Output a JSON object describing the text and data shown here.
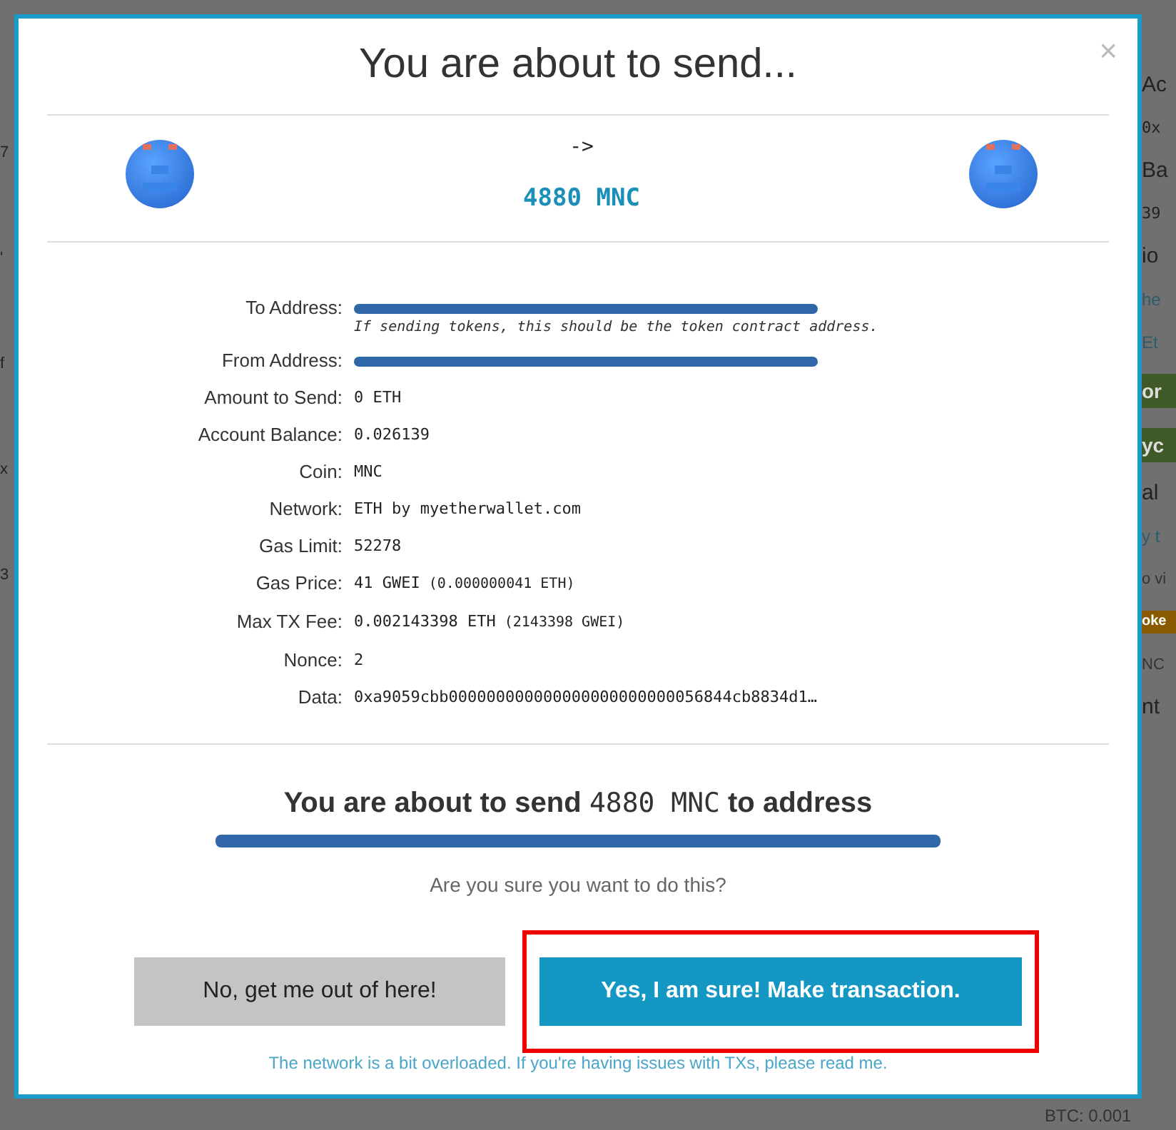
{
  "backdrop": {
    "left_fragments": [
      "7",
      "'",
      "f",
      "x",
      "3"
    ],
    "right_fragments": [
      {
        "text": "Ac",
        "kind": "heading"
      },
      {
        "text": "0x",
        "kind": "mono"
      },
      {
        "text": "Ba",
        "kind": "heading"
      },
      {
        "text": "39",
        "kind": "mono"
      },
      {
        "text": "io",
        "kind": "heading"
      },
      {
        "text": "he",
        "kind": "link"
      },
      {
        "text": "Et",
        "kind": "link"
      },
      {
        "text": "or",
        "kind": "banner"
      },
      {
        "text": "yc",
        "kind": "banner"
      },
      {
        "text": "al",
        "kind": "heading"
      },
      {
        "text": "y t",
        "kind": "link"
      },
      {
        "text": "o vi",
        "kind": "muted"
      },
      {
        "text": "oke",
        "kind": "tag"
      },
      {
        "text": "NC",
        "kind": "muted"
      },
      {
        "text": "nt",
        "kind": "heading"
      }
    ],
    "bottom_fragment": "BTC: 0.001"
  },
  "modal": {
    "title": "You are about to send...",
    "close": "×",
    "transfer": {
      "arrow": "->",
      "amount": "4880 MNC"
    },
    "details": [
      {
        "label": "To Address:",
        "redacted": true,
        "note": "If sending tokens, this should be the token contract address."
      },
      {
        "label": "From Address:",
        "redacted": true
      },
      {
        "label": "Amount to Send:",
        "value": "0 ETH"
      },
      {
        "label": "Account Balance:",
        "value": "0.026139"
      },
      {
        "label": "Coin:",
        "value": "MNC"
      },
      {
        "label": "Network:",
        "value": "ETH by myetherwallet.com"
      },
      {
        "label": "Gas Limit:",
        "value": "52278"
      },
      {
        "label": "Gas Price:",
        "value": "41 GWEI",
        "extra": "(0.000000041 ETH)"
      },
      {
        "label": "Max TX Fee:",
        "value": "0.002143398 ETH",
        "extra": "(2143398 GWEI)"
      },
      {
        "label": "Nonce:",
        "value": "2"
      },
      {
        "label": "Data:",
        "value": "0xa9059cbb000000000000000000000000056844cb8834d1…"
      }
    ],
    "summary": {
      "prefix": "You are about to send",
      "amount": "4880 MNC",
      "suffix": "to address",
      "address_redacted": true
    },
    "question": "Are you sure you want to do this?",
    "buttons": [
      {
        "label": "No, get me out of here!",
        "kind": "cancel",
        "highlighted": false
      },
      {
        "label": "Yes, I am sure! Make transaction.",
        "kind": "confirm",
        "highlighted": true
      }
    ],
    "footer_link": "The network is a bit overloaded. If you're having issues with TXs, please read me."
  }
}
